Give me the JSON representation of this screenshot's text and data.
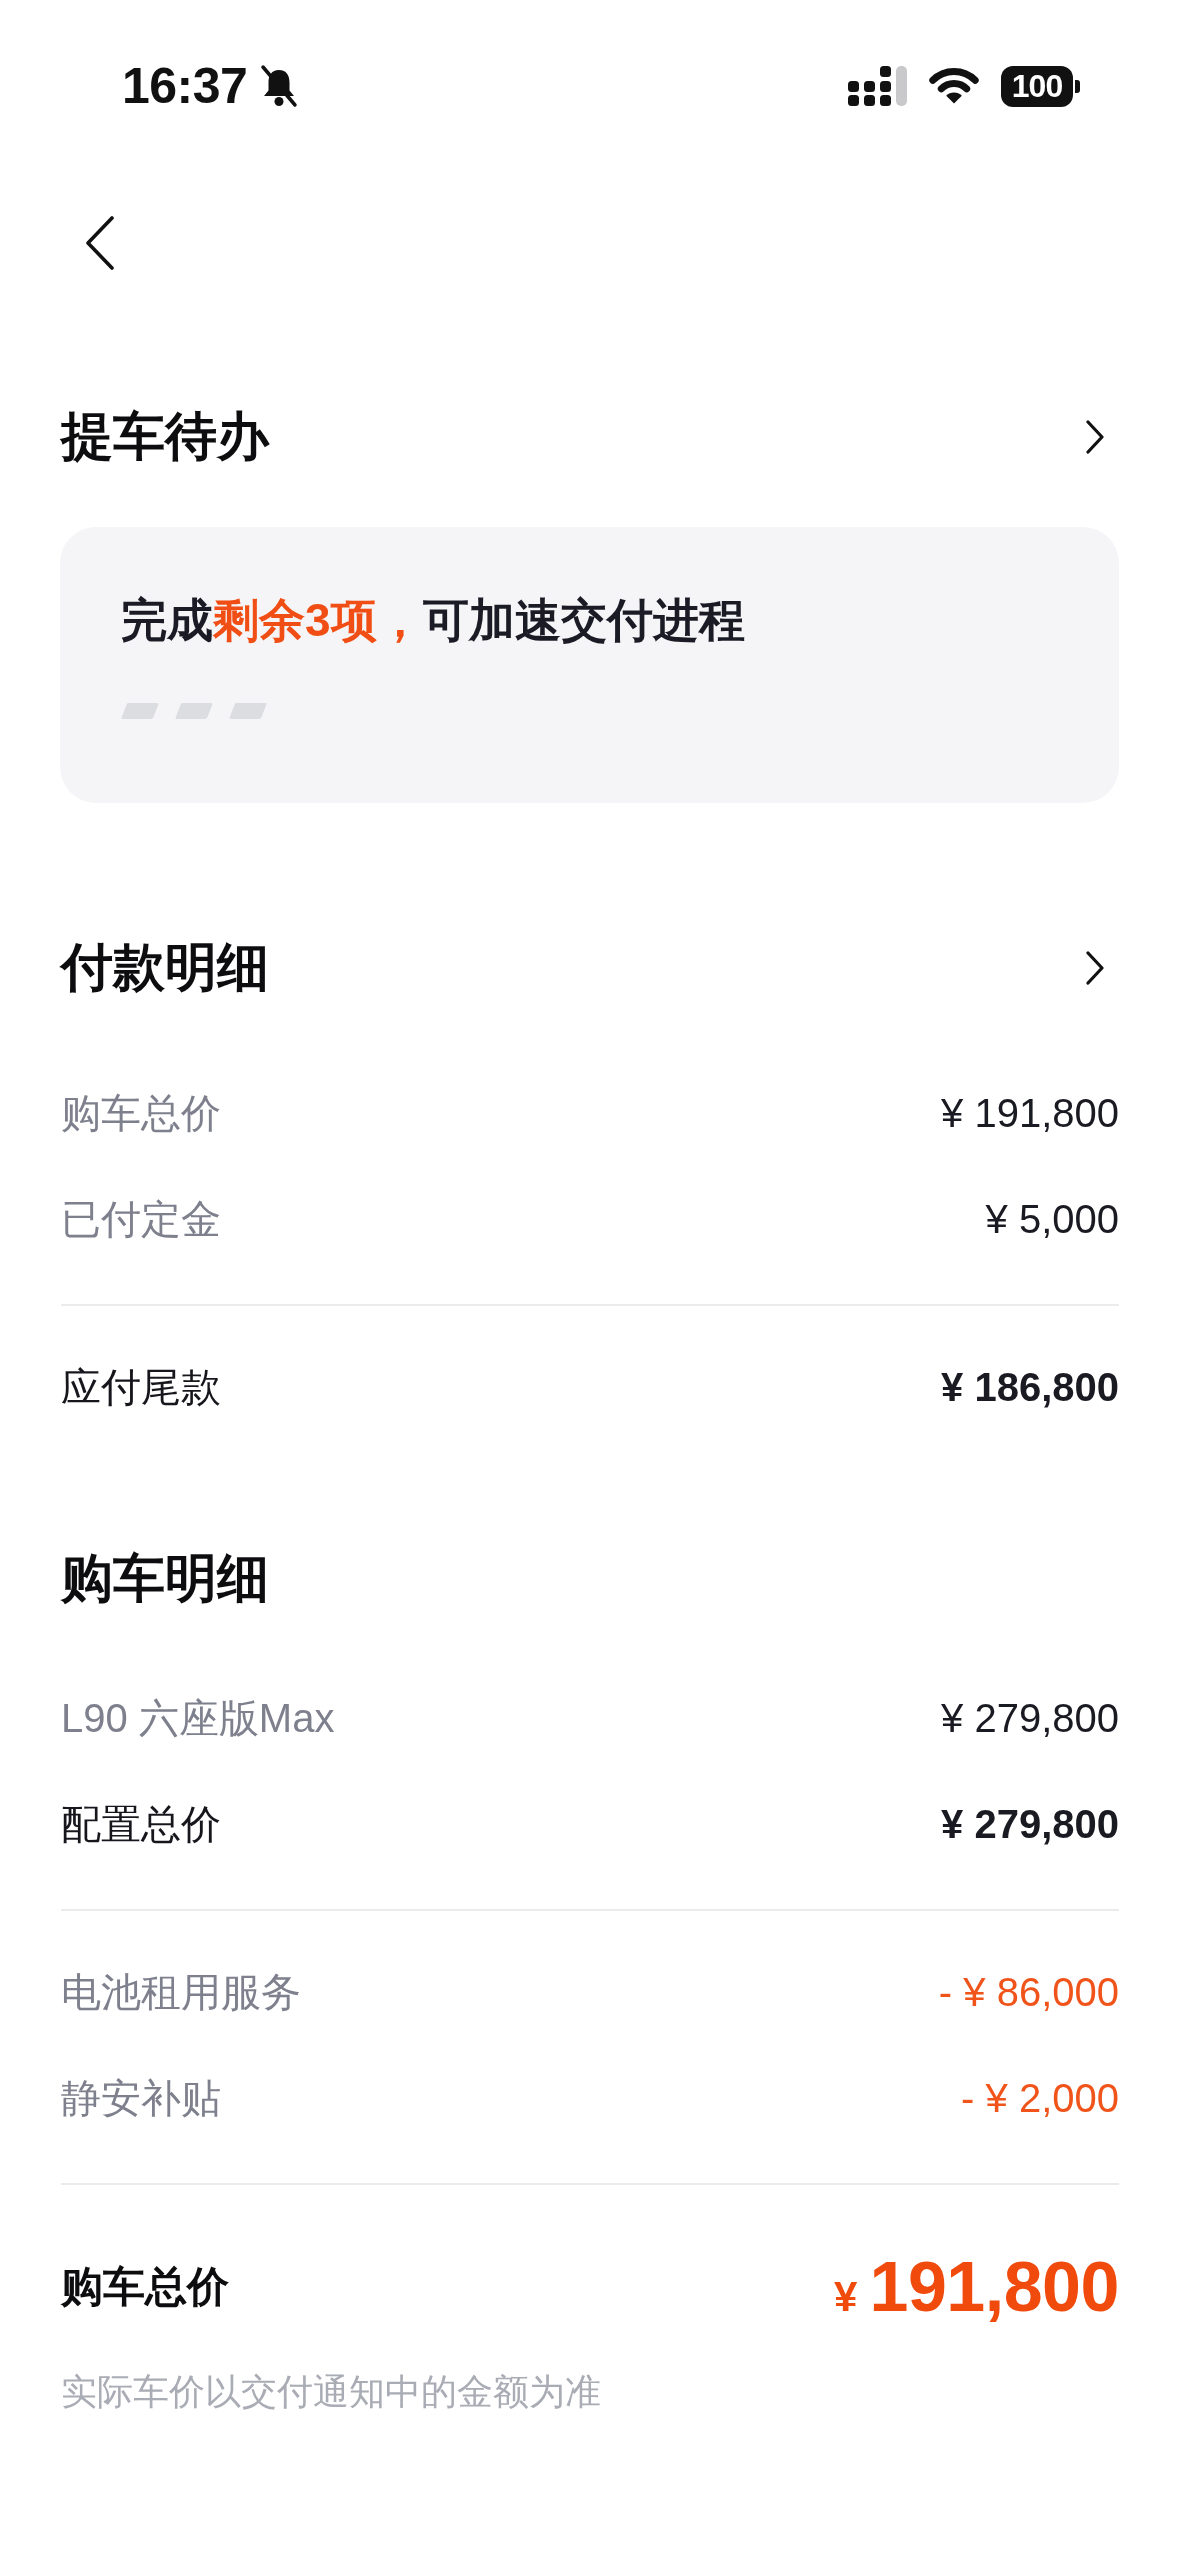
{
  "status_bar": {
    "time": "16:37",
    "battery": "100"
  },
  "todo": {
    "title": "提车待办",
    "more": true,
    "message": {
      "lead": "完成",
      "highlight": "剩余3项，",
      "tail": "可加速交付进程"
    }
  },
  "payment": {
    "title": "付款明细",
    "more": true,
    "groups": [
      [
        {
          "kind": "item",
          "label": "购车总价",
          "value": "¥ 191,800"
        },
        {
          "kind": "item",
          "label": "已付定金",
          "value": "¥ 5,000"
        }
      ],
      [
        {
          "kind": "total",
          "label": "应付尾款",
          "value": "¥ 186,800"
        }
      ]
    ]
  },
  "purchase": {
    "title": "购车明细",
    "groups": [
      [
        {
          "kind": "item",
          "label": "L90 六座版Max",
          "value": "¥ 279,800"
        },
        {
          "kind": "total",
          "label": "配置总价",
          "value": "¥ 279,800"
        }
      ],
      [
        {
          "kind": "discount",
          "label": "电池租用服务",
          "value": "- ¥ 86,000"
        },
        {
          "kind": "discount",
          "label": "静安补贴",
          "value": "- ¥ 2,000"
        }
      ],
      [
        {
          "kind": "grand",
          "label": "购车总价",
          "currency": "¥",
          "amount": "191,800"
        }
      ]
    ],
    "note": "实际车价以交付通知中的金额为准"
  }
}
